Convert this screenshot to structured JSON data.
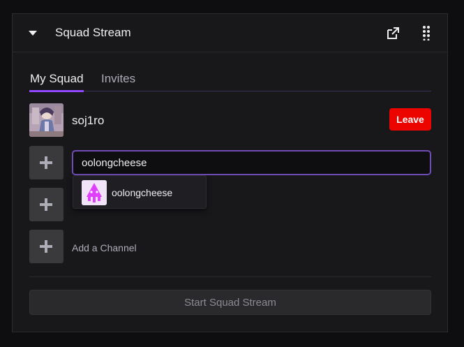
{
  "panel": {
    "title": "Squad Stream",
    "collapse_icon": "caret-down-icon",
    "popout_icon": "popout-icon",
    "drag_icon": "drag-handle-icon"
  },
  "tabs": [
    {
      "label": "My Squad",
      "active": true
    },
    {
      "label": "Invites",
      "active": false
    }
  ],
  "member": {
    "name": "soj1ro",
    "leave_label": "Leave"
  },
  "input": {
    "value": "oolongcheese"
  },
  "suggestion": {
    "name": "oolongcheese"
  },
  "add_channel": {
    "placeholder": "Add a Channel"
  },
  "start_button": {
    "label": "Start Squad Stream"
  },
  "colors": {
    "accent": "#9147ff",
    "leave": "#eb0400",
    "background": "#18181b"
  }
}
